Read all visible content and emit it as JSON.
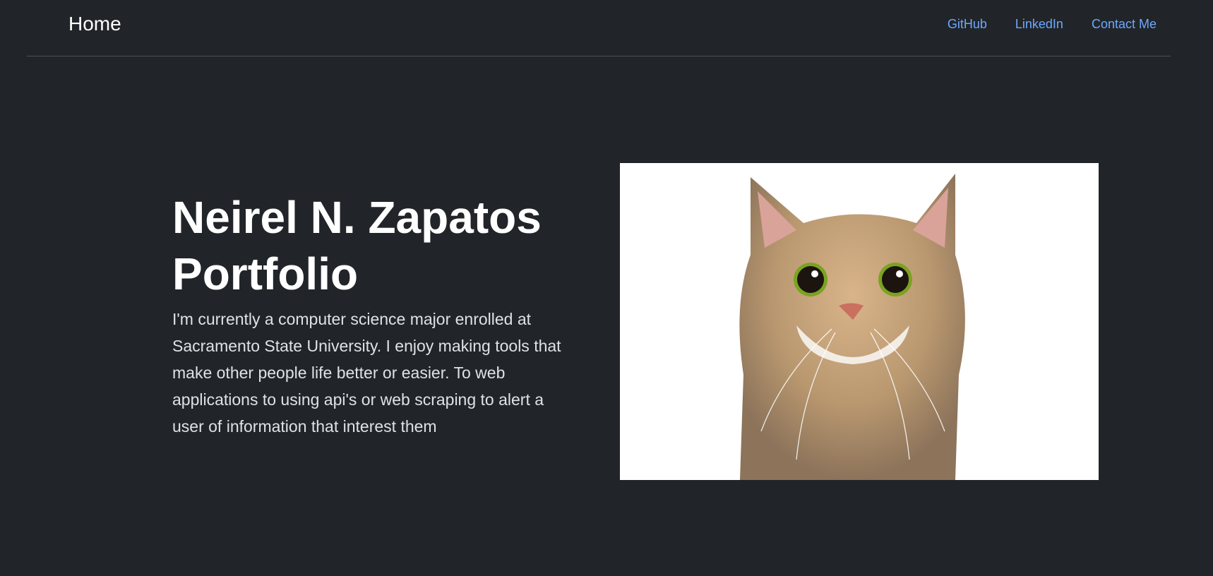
{
  "navbar": {
    "brand": "Home",
    "links": [
      "GitHub",
      "LinkedIn",
      "Contact Me"
    ]
  },
  "hero": {
    "title_lines": [
      "Neirel N. Zapatos",
      "Portfolio"
    ],
    "description_lines": [
      "I'm currently a computer science major enrolled at",
      "Sacramento State University. I enjoy making tools that",
      "make other people life better or easier. To web",
      "applications to using api's or web scraping to alert a",
      "user of information that interest them"
    ],
    "image_subject": "cat-photo"
  },
  "colors": {
    "background": "#212529",
    "link": "#6ea8fe",
    "text": "#ffffff"
  }
}
